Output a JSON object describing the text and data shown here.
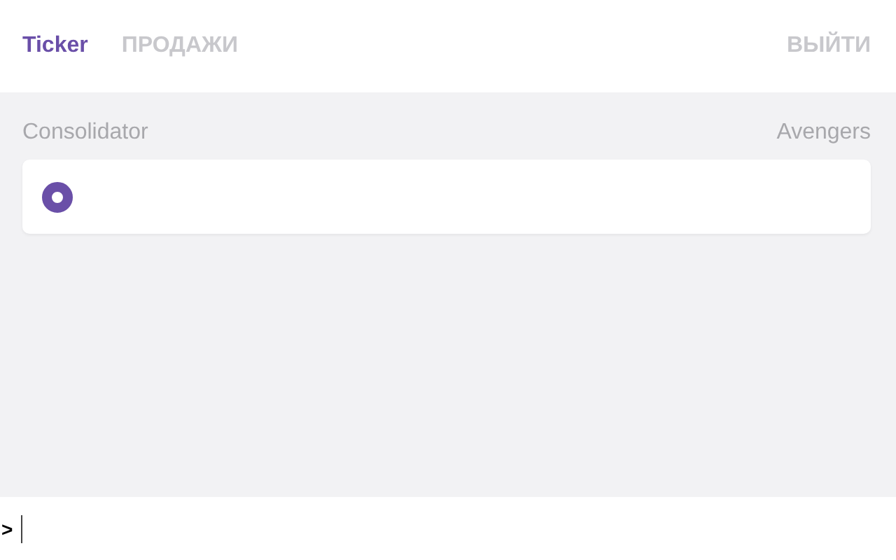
{
  "tabs": [
    {
      "label": "Ticker",
      "selected": true
    },
    {
      "label": "ПРОДАЖИ",
      "selected": false
    }
  ],
  "logout": "ВЫЙТИ",
  "section": {
    "left_label": "Consolidator",
    "right_label": "Avengers"
  },
  "card": {
    "radio": {
      "selected": true
    }
  },
  "console": {
    "prompt": ">"
  }
}
